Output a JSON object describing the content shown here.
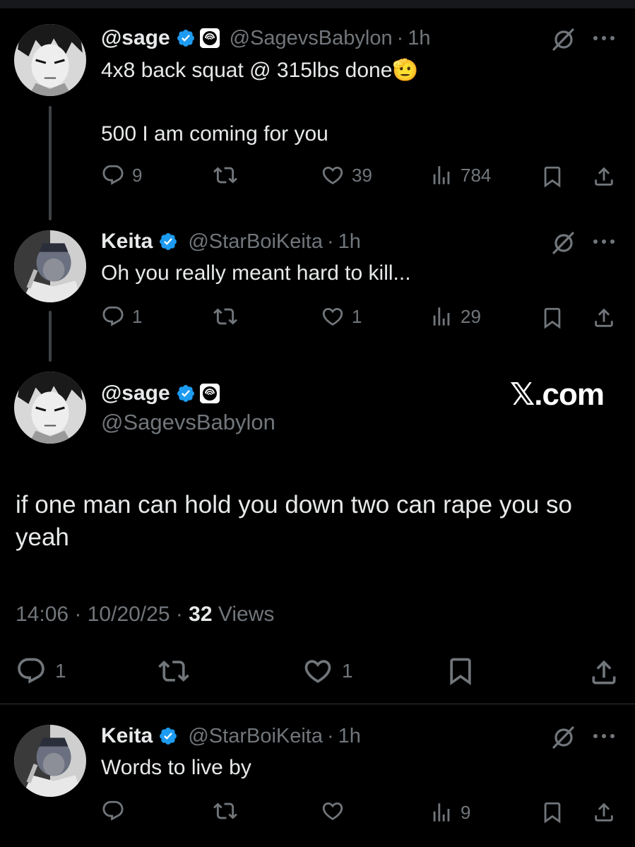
{
  "tweets": [
    {
      "name": "@sage",
      "handle": "@SagevsBabylon",
      "separator": "·",
      "time": "1h",
      "text_line1": "4x8 back squat @ 315lbs done🫡",
      "text_line2": "500 I am coming for you",
      "replies": "9",
      "reposts": "",
      "likes": "39",
      "views": "784"
    },
    {
      "name": "Keita",
      "handle": "@StarBoiKeita",
      "separator": "·",
      "time": "1h",
      "text_line1": "Oh you really meant hard to kill...",
      "replies": "1",
      "reposts": "",
      "likes": "1",
      "views": "29"
    }
  ],
  "main_tweet": {
    "name": "@sage",
    "handle": "@SagevsBabylon",
    "brand": "𝕏.com",
    "text": "if one man can hold you down two can rape you so yeah",
    "timestamp": "14:06 · 10/20/25 · ",
    "views_count": "32",
    "views_label": " Views",
    "replies": "1",
    "reposts": "",
    "likes": "1"
  },
  "reply": {
    "name": "Keita",
    "handle": "@StarBoiKeita",
    "separator": "·",
    "time": "1h",
    "text": "Words to live by",
    "replies": "",
    "reposts": "",
    "likes": "",
    "views": "9"
  },
  "colors": {
    "background": "#000000",
    "text": "#e7e9ea",
    "muted": "#71767b",
    "verified": "#1d9bf0",
    "thread_line": "#3e4144"
  },
  "icons": {
    "reply": "reply-icon",
    "repost": "repost-icon",
    "like": "like-icon",
    "views": "views-icon",
    "bookmark": "bookmark-icon",
    "share": "share-icon",
    "grok": "grok-icon",
    "more": "more-icon",
    "verified": "verified-badge-icon",
    "affiliate": "affiliate-badge-icon"
  }
}
